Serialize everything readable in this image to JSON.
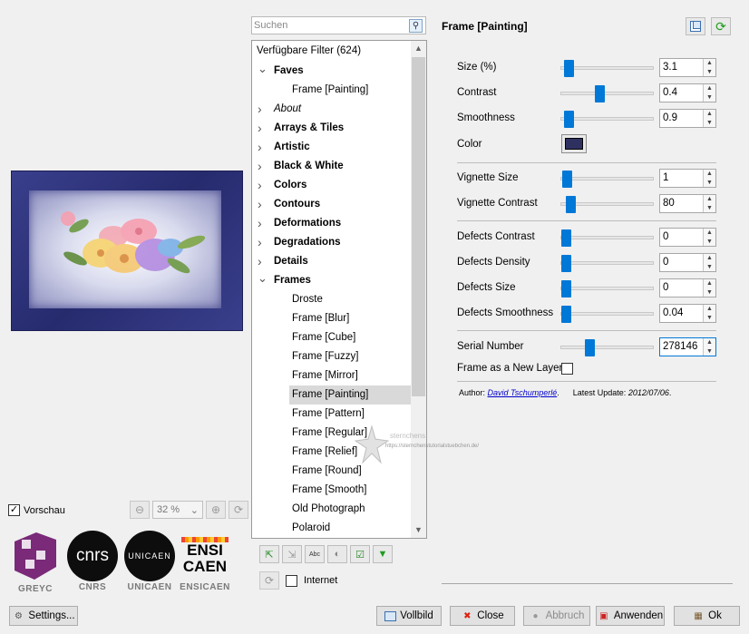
{
  "preview": {
    "checkbox_label": "Vorschau",
    "checked": true,
    "zoom_value": "32 %"
  },
  "logos": [
    {
      "caption": "GREYC"
    },
    {
      "caption": "CNRS",
      "text": "cnrs"
    },
    {
      "caption": "UNICAEN",
      "text": "UNICAEN"
    },
    {
      "caption": "ENSICAEN",
      "text1": "ENSI",
      "text2": "CAEN"
    }
  ],
  "search": {
    "placeholder": "Suchen"
  },
  "tree": {
    "items": [
      {
        "label": "Verfügbare Filter (624)",
        "level": 0,
        "style": "normal",
        "arrow": ""
      },
      {
        "label": "Faves",
        "level": 1,
        "style": "bold",
        "arrow": "expanded"
      },
      {
        "label": "Frame [Painting]",
        "level": 2,
        "style": "normal",
        "arrow": ""
      },
      {
        "label": "About",
        "level": 1,
        "style": "italic",
        "arrow": "collapsed"
      },
      {
        "label": "Arrays & Tiles",
        "level": 1,
        "style": "bold",
        "arrow": "collapsed"
      },
      {
        "label": "Artistic",
        "level": 1,
        "style": "bold",
        "arrow": "collapsed"
      },
      {
        "label": "Black & White",
        "level": 1,
        "style": "bold",
        "arrow": "collapsed"
      },
      {
        "label": "Colors",
        "level": 1,
        "style": "bold",
        "arrow": "collapsed"
      },
      {
        "label": "Contours",
        "level": 1,
        "style": "bold",
        "arrow": "collapsed"
      },
      {
        "label": "Deformations",
        "level": 1,
        "style": "bold",
        "arrow": "collapsed"
      },
      {
        "label": "Degradations",
        "level": 1,
        "style": "bold",
        "arrow": "collapsed"
      },
      {
        "label": "Details",
        "level": 1,
        "style": "bold",
        "arrow": "collapsed"
      },
      {
        "label": "Frames",
        "level": 1,
        "style": "bold",
        "arrow": "expanded"
      },
      {
        "label": "Droste",
        "level": 2,
        "style": "normal",
        "arrow": ""
      },
      {
        "label": "Frame [Blur]",
        "level": 2,
        "style": "normal",
        "arrow": ""
      },
      {
        "label": "Frame [Cube]",
        "level": 2,
        "style": "normal",
        "arrow": ""
      },
      {
        "label": "Frame [Fuzzy]",
        "level": 2,
        "style": "normal",
        "arrow": ""
      },
      {
        "label": "Frame [Mirror]",
        "level": 2,
        "style": "normal",
        "arrow": ""
      },
      {
        "label": "Frame [Painting]",
        "level": 2,
        "style": "normal",
        "arrow": "",
        "selected": true
      },
      {
        "label": "Frame [Pattern]",
        "level": 2,
        "style": "normal",
        "arrow": ""
      },
      {
        "label": "Frame [Regular]",
        "level": 2,
        "style": "normal",
        "arrow": ""
      },
      {
        "label": "Frame [Relief]",
        "level": 2,
        "style": "normal",
        "arrow": ""
      },
      {
        "label": "Frame [Round]",
        "level": 2,
        "style": "normal",
        "arrow": ""
      },
      {
        "label": "Frame [Smooth]",
        "level": 2,
        "style": "normal",
        "arrow": ""
      },
      {
        "label": "Old Photograph",
        "level": 2,
        "style": "normal",
        "arrow": ""
      },
      {
        "label": "Polaroid",
        "level": 2,
        "style": "normal",
        "arrow": ""
      }
    ]
  },
  "tree_tools": {
    "internet_label": "Internet",
    "internet_checked": false
  },
  "filter": {
    "title": "Frame [Painting]",
    "params": [
      {
        "label": "Size (%)",
        "value": "3.1",
        "slider": 0.03
      },
      {
        "label": "Contrast",
        "value": "0.4",
        "slider": 0.4
      },
      {
        "label": "Smoothness",
        "value": "0.9",
        "slider": 0.03
      },
      {
        "label": "Color",
        "color": "#2e3160"
      },
      {
        "label": "Vignette Size",
        "value": "1",
        "slider": 0.01
      },
      {
        "label": "Vignette Contrast",
        "value": "80",
        "slider": 0.05
      },
      {
        "label": "Defects Contrast",
        "value": "0",
        "slider": 0.0
      },
      {
        "label": "Defects Density",
        "value": "0",
        "slider": 0.0
      },
      {
        "label": "Defects Size",
        "value": "0",
        "slider": 0.0
      },
      {
        "label": "Defects Smoothness",
        "value": "0.04",
        "slider": 0.0
      },
      {
        "label": "Serial Number",
        "value": "278146",
        "slider": 0.28
      },
      {
        "label": "Frame as a New Layer",
        "checked": false
      }
    ],
    "author_label": "Author:",
    "author_name": "David Tschumperlé",
    "update_label": "Latest Update:",
    "update_value": "2012/07/06"
  },
  "watermark": {
    "line1": "sternchens",
    "line2": "https://sternchenstutorialstuebchen.de/"
  },
  "buttons": {
    "settings": "Settings...",
    "fullscreen": "Vollbild",
    "close": "Close",
    "cancel": "Abbruch",
    "apply": "Anwenden",
    "ok": "Ok"
  },
  "colors": {
    "accent": "#0078d7",
    "selected_row": "#d9d9d9",
    "frame_blue": "#2e3160"
  }
}
